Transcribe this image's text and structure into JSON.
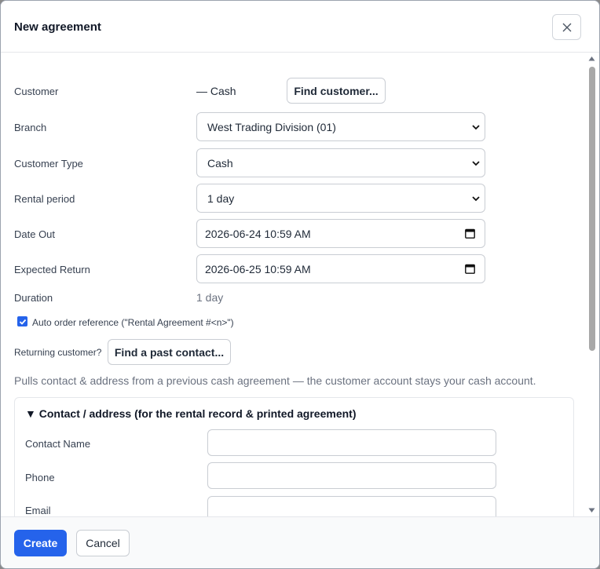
{
  "dialog": {
    "title": "New agreement",
    "close_icon": "close-icon"
  },
  "form": {
    "customer": {
      "label": "Customer",
      "value": "— Cash",
      "button": "Find customer..."
    },
    "branch": {
      "label": "Branch",
      "value": "West Trading Division (01)"
    },
    "customer_type": {
      "label": "Customer Type",
      "value": "Cash"
    },
    "rental_period": {
      "label": "Rental period",
      "value": "1 day"
    },
    "date_out": {
      "label": "Date Out",
      "value": "2026-06-24 10:59 AM"
    },
    "expected_return": {
      "label": "Expected Return",
      "value": "2026-06-25 10:59 AM"
    },
    "duration": {
      "label": "Duration",
      "value": "1 day"
    },
    "auto_order": {
      "label": "Auto order reference (\"Rental Agreement #<n>\")",
      "checked": true
    },
    "returning": {
      "label": "Returning customer?",
      "button": "Find a past contact..."
    },
    "hint": "Pulls contact & address from a previous cash agreement — the customer account stays your cash account."
  },
  "contact_section": {
    "title": "▼ Contact / address (for the rental record & printed agreement)",
    "fields": [
      {
        "label": "Contact Name",
        "value": ""
      },
      {
        "label": "Phone",
        "value": ""
      },
      {
        "label": "Email",
        "value": ""
      }
    ]
  },
  "footer": {
    "create_label": "Create",
    "cancel_label": "Cancel"
  },
  "colors": {
    "accent": "#2563eb",
    "border": "#c9cdd3",
    "muted_text": "#6b7280"
  }
}
